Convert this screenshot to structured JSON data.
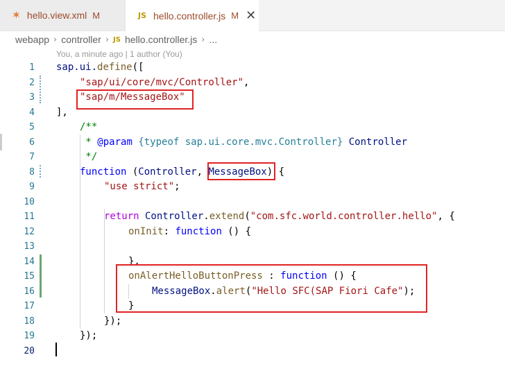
{
  "tabs": [
    {
      "icon": "rss-icon",
      "glyph": "✶",
      "label": "hello.view.xml",
      "status": "M"
    },
    {
      "icon": "js-icon",
      "glyph": "JS",
      "label": "hello.controller.js",
      "status": "M",
      "close": "✕"
    }
  ],
  "breadcrumb": {
    "items": [
      "webapp",
      "controller",
      "hello.controller.js",
      "..."
    ],
    "sep": "›",
    "js_glyph": "JS"
  },
  "blame": "You, a minute ago | 1 author (You)",
  "line_numbers": [
    "1",
    "2",
    "3",
    "4",
    "5",
    "6",
    "7",
    "8",
    "9",
    "10",
    "11",
    "12",
    "13",
    "14",
    "15",
    "16",
    "17",
    "18",
    "19",
    "20"
  ],
  "code": {
    "l1a": "sap.ui.",
    "l1b": "define",
    "l1c": "([",
    "l2": "\"sap/ui/core/mvc/Controller\"",
    "l2c": ",",
    "l3": "\"sap/m/MessageBox\"",
    "l4": "],",
    "l5": "/**",
    "l6a": " * ",
    "l6b": "@param",
    "l6c": " {typeof sap.ui.core.mvc.Controller} ",
    "l6d": "Controller",
    "l7": " */",
    "l8a": "function",
    "l8b": " (",
    "l8c": "Controller",
    "l8d": ", ",
    "l8e": "MessageBox",
    "l8f": ") {",
    "l9": "\"use strict\"",
    "l9c": ";",
    "l11a": "return",
    "l11b": " Controller",
    "l11c": ".",
    "l11d": "extend",
    "l11e": "(",
    "l11f": "\"com.sfc.world.controller.hello\"",
    "l11g": ", {",
    "l12a": "onInit",
    "l12b": ": ",
    "l12c": "function",
    "l12d": " () {",
    "l14": "},",
    "l15a": "onAlertHelloButtonPress",
    "l15b": " : ",
    "l15c": "function",
    "l15d": " () {",
    "l16a": "MessageBox",
    "l16b": ".",
    "l16c": "alert",
    "l16d": "(",
    "l16e": "\"Hello SFC(SAP Fiori Cafe\"",
    "l16f": ");",
    "l17": "}",
    "l18": "});",
    "l19": "});"
  }
}
